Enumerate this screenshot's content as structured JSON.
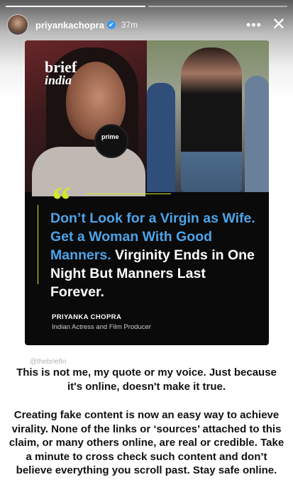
{
  "story": {
    "segments": [
      {
        "progress": 1.0
      },
      {
        "progress": 0.0
      }
    ],
    "username": "priyankachopra",
    "verified_glyph": "✔",
    "time": "37m",
    "more_label": "•••",
    "close_label": "✕"
  },
  "card": {
    "brand_line1": "brief",
    "brand_line2": "india",
    "mic_label": "prime",
    "quote_mark": "“",
    "quote_highlight": "Don’t Look for a Virgin as Wife. Get a Woman With Good Manners.",
    "quote_rest": " Virginity Ends in One Night But Manners Last Forever.",
    "author_name": "PRIYANKA CHOPRA",
    "author_role": "Indian Actress and Film Producer",
    "colors": {
      "accent": "#d4e82a",
      "highlight": "#4da3e8",
      "background": "#0a0a0a"
    }
  },
  "overlay": {
    "handle": "@thebriefin",
    "caption1": "This is not me, my quote or my voice. Just because it's online, doesn't make it true.",
    "caption2": "Creating fake content is now an easy way to achieve virality. None of the links or ‘sources’ attached to this claim, or many others online, are real or credible. Take a minute to cross check such content and don’t believe everything you scroll past. Stay safe online."
  }
}
